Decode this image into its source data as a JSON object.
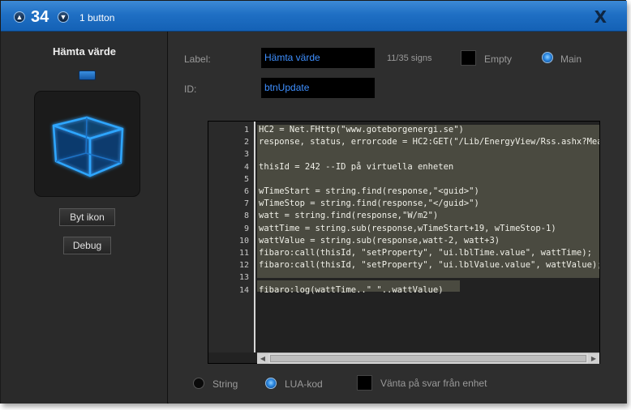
{
  "titlebar": {
    "number": "34",
    "subtitle": "1 button",
    "up_icon": "chevron-up-icon",
    "down_icon": "chevron-down-icon",
    "close_label": "X"
  },
  "sidebar": {
    "title": "Hämta värde",
    "icon": "3d-cube-icon",
    "byt_ikon_label": "Byt ikon",
    "debug_label": "Debug"
  },
  "form": {
    "label_caption": "Label:",
    "label_value": "Hämta värde",
    "counter": "11/35 signs",
    "empty_label": "Empty",
    "main_label": "Main",
    "main_selected": true,
    "id_caption": "ID:",
    "id_value": "btnUpdate"
  },
  "code": {
    "lines": [
      "HC2 = Net.FHttp(\"www.goteborgenergi.se\")",
      "response, status, errorcode = HC2:GET(\"/Lib/EnergyView/Rss.ashx?Mea",
      "",
      "thisId = 242 --ID på virtuella enheten",
      "",
      "wTimeStart = string.find(response,\"<guid>\")",
      "wTimeStop = string.find(response,\"</guid>\")",
      "watt = string.find(response,\"W/m2\")",
      "wattTime = string.sub(response,wTimeStart+19, wTimeStop-1)",
      "wattValue = string.sub(response,watt-2, watt+3)",
      "fibaro:call(thisId, \"setProperty\", \"ui.lblTime.value\", wattTime);",
      "fibaro:call(thisId, \"setProperty\", \"ui.lblValue.value\", wattValue);",
      "",
      "fibaro:log(wattTime..\" \"..wattValue)"
    ],
    "line_numbers": [
      "1",
      "2",
      "3",
      "4",
      "5",
      "6",
      "7",
      "8",
      "9",
      "10",
      "11",
      "12",
      "13",
      "14"
    ]
  },
  "bottom": {
    "string_label": "String",
    "lua_label": "LUA-kod",
    "selected": "LUA-kod",
    "wait_label": "Vänta på svar från enhet"
  }
}
